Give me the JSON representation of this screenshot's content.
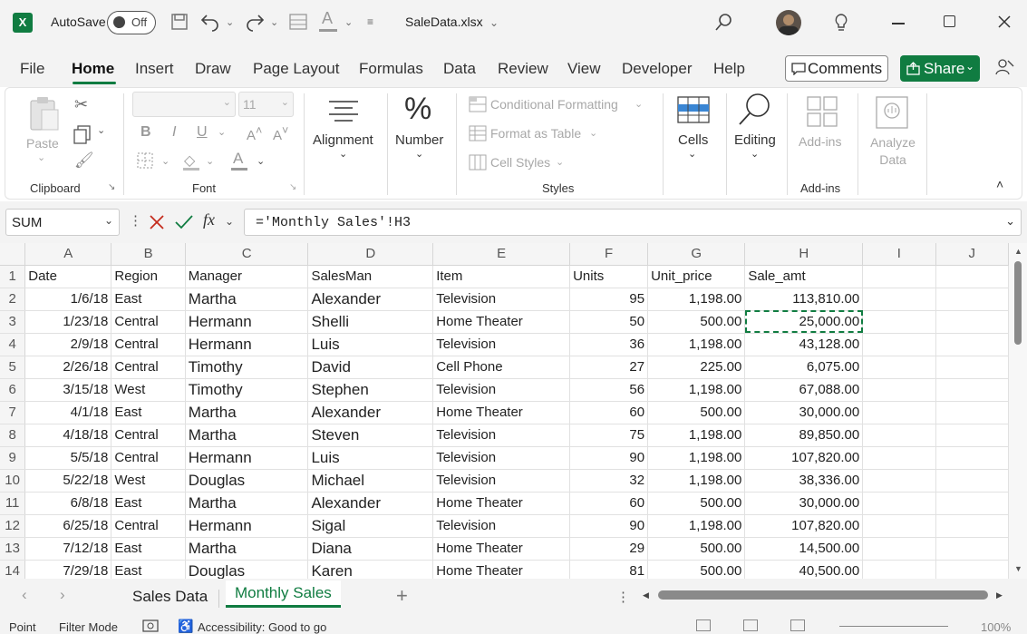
{
  "titlebar": {
    "logo": "X",
    "autosave_label": "AutoSave",
    "autosave_state": "Off",
    "filename": "SaleData.xlsx",
    "icons": [
      "excel-logo-icon",
      "save-icon",
      "undo-icon",
      "redo-icon",
      "font-color-icon",
      "customize-icon",
      "search-icon",
      "avatar",
      "lightbulb-icon",
      "minimize-icon",
      "maximize-icon",
      "close-icon"
    ]
  },
  "ribbon_tabs": [
    "File",
    "Home",
    "Insert",
    "Draw",
    "Page Layout",
    "Formulas",
    "Data",
    "Review",
    "View",
    "Developer",
    "Help"
  ],
  "active_tab": "Home",
  "comments_label": "Comments",
  "share_label": "Share",
  "ribbon": {
    "clipboard": {
      "paste": "Paste",
      "label": "Clipboard"
    },
    "font": {
      "size": "11",
      "label": "Font",
      "bold": "B",
      "italic": "I",
      "underline": "U"
    },
    "alignment": "Alignment",
    "number": "Number",
    "styles": {
      "conditional": "Conditional Formatting",
      "format_table": "Format as Table",
      "cell_styles": "Cell Styles",
      "label": "Styles"
    },
    "cells": "Cells",
    "editing": "Editing",
    "addins": {
      "button": "Add-ins",
      "label": "Add-ins"
    },
    "analyze": "Analyze Data"
  },
  "formula_bar": {
    "namebox": "SUM",
    "fx": "fx",
    "formula": "='Monthly Sales'!H3"
  },
  "grid": {
    "columns": [
      "A",
      "B",
      "C",
      "D",
      "E",
      "F",
      "G",
      "H",
      "I",
      "J"
    ],
    "rows": [
      [
        "1",
        "Date",
        "Region",
        "Manager",
        "SalesMan",
        "Item",
        "Units",
        "Unit_price",
        "Sale_amt",
        "",
        ""
      ],
      [
        "2",
        "1/6/18",
        "East",
        "Martha",
        "Alexander",
        "Television",
        "95",
        "1,198.00",
        "113,810.00",
        "",
        ""
      ],
      [
        "3",
        "1/23/18",
        "Central",
        "Hermann",
        "Shelli",
        "Home Theater",
        "50",
        "500.00",
        "25,000.00",
        "",
        ""
      ],
      [
        "4",
        "2/9/18",
        "Central",
        "Hermann",
        "Luis",
        "Television",
        "36",
        "1,198.00",
        "43,128.00",
        "",
        ""
      ],
      [
        "5",
        "2/26/18",
        "Central",
        "Timothy",
        "David",
        "Cell Phone",
        "27",
        "225.00",
        "6,075.00",
        "",
        ""
      ],
      [
        "6",
        "3/15/18",
        "West",
        "Timothy",
        "Stephen",
        "Television",
        "56",
        "1,198.00",
        "67,088.00",
        "",
        ""
      ],
      [
        "7",
        "4/1/18",
        "East",
        "Martha",
        "Alexander",
        "Home Theater",
        "60",
        "500.00",
        "30,000.00",
        "",
        ""
      ],
      [
        "8",
        "4/18/18",
        "Central",
        "Martha",
        "Steven",
        "Television",
        "75",
        "1,198.00",
        "89,850.00",
        "",
        ""
      ],
      [
        "9",
        "5/5/18",
        "Central",
        "Hermann",
        "Luis",
        "Television",
        "90",
        "1,198.00",
        "107,820.00",
        "",
        ""
      ],
      [
        "10",
        "5/22/18",
        "West",
        "Douglas",
        "Michael",
        "Television",
        "32",
        "1,198.00",
        "38,336.00",
        "",
        ""
      ],
      [
        "11",
        "6/8/18",
        "East",
        "Martha",
        "Alexander",
        "Home Theater",
        "60",
        "500.00",
        "30,000.00",
        "",
        ""
      ],
      [
        "12",
        "6/25/18",
        "Central",
        "Hermann",
        "Sigal",
        "Television",
        "90",
        "1,198.00",
        "107,820.00",
        "",
        ""
      ],
      [
        "13",
        "7/12/18",
        "East",
        "Martha",
        "Diana",
        "Home Theater",
        "29",
        "500.00",
        "14,500.00",
        "",
        ""
      ],
      [
        "14",
        "7/29/18",
        "East",
        "Douglas",
        "Karen",
        "Home Theater",
        "81",
        "500.00",
        "40,500.00",
        "",
        ""
      ]
    ]
  },
  "sheets": [
    "Sales Data",
    "Monthly Sales"
  ],
  "active_sheet": "Monthly Sales",
  "status": {
    "mode": "Point",
    "filter": "Filter Mode",
    "accessibility": "Accessibility: Good to go",
    "zoom": "100%"
  },
  "colors": {
    "accent": "#107c41",
    "chrome": "#f3f3f3"
  }
}
